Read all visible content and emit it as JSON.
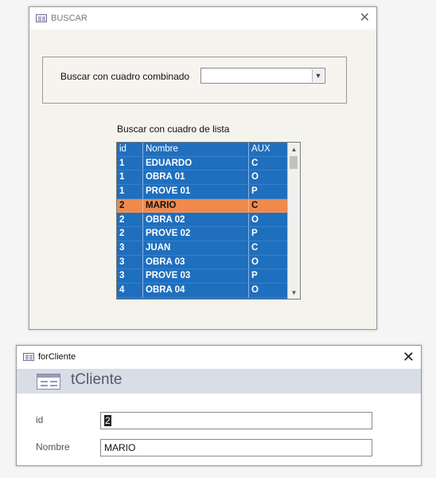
{
  "buscar": {
    "title": "BUSCAR",
    "combo_label": "Buscar con cuadro combinado",
    "combo_value": "",
    "list_label": "Buscar con cuadro de lista",
    "list": {
      "columns": [
        "id",
        "Nombre",
        "AUX"
      ],
      "rows": [
        {
          "id": "1",
          "nombre": "EDUARDO",
          "aux": "C",
          "selected": false
        },
        {
          "id": "1",
          "nombre": "OBRA 01",
          "aux": "O",
          "selected": false
        },
        {
          "id": "1",
          "nombre": "PROVE 01",
          "aux": "P",
          "selected": false
        },
        {
          "id": "2",
          "nombre": "MARIO",
          "aux": "C",
          "selected": true
        },
        {
          "id": "2",
          "nombre": "OBRA 02",
          "aux": "O",
          "selected": false
        },
        {
          "id": "2",
          "nombre": "PROVE 02",
          "aux": "P",
          "selected": false
        },
        {
          "id": "3",
          "nombre": "JUAN",
          "aux": "C",
          "selected": false
        },
        {
          "id": "3",
          "nombre": "OBRA 03",
          "aux": "O",
          "selected": false
        },
        {
          "id": "3",
          "nombre": "PROVE 03",
          "aux": "P",
          "selected": false
        },
        {
          "id": "4",
          "nombre": "OBRA 04",
          "aux": "O",
          "selected": false
        }
      ]
    },
    "close_glyph": "✕"
  },
  "forcliente": {
    "title": "forCliente",
    "header_title": "tCliente",
    "fields": {
      "id_label": "id",
      "id_value": "2",
      "nombre_label": "Nombre",
      "nombre_value": "MARIO"
    },
    "close_glyph": "✕"
  },
  "colors": {
    "list_background": "#1f6fbf",
    "selected_row": "#f0894b",
    "header_band": "#d9dde6"
  }
}
